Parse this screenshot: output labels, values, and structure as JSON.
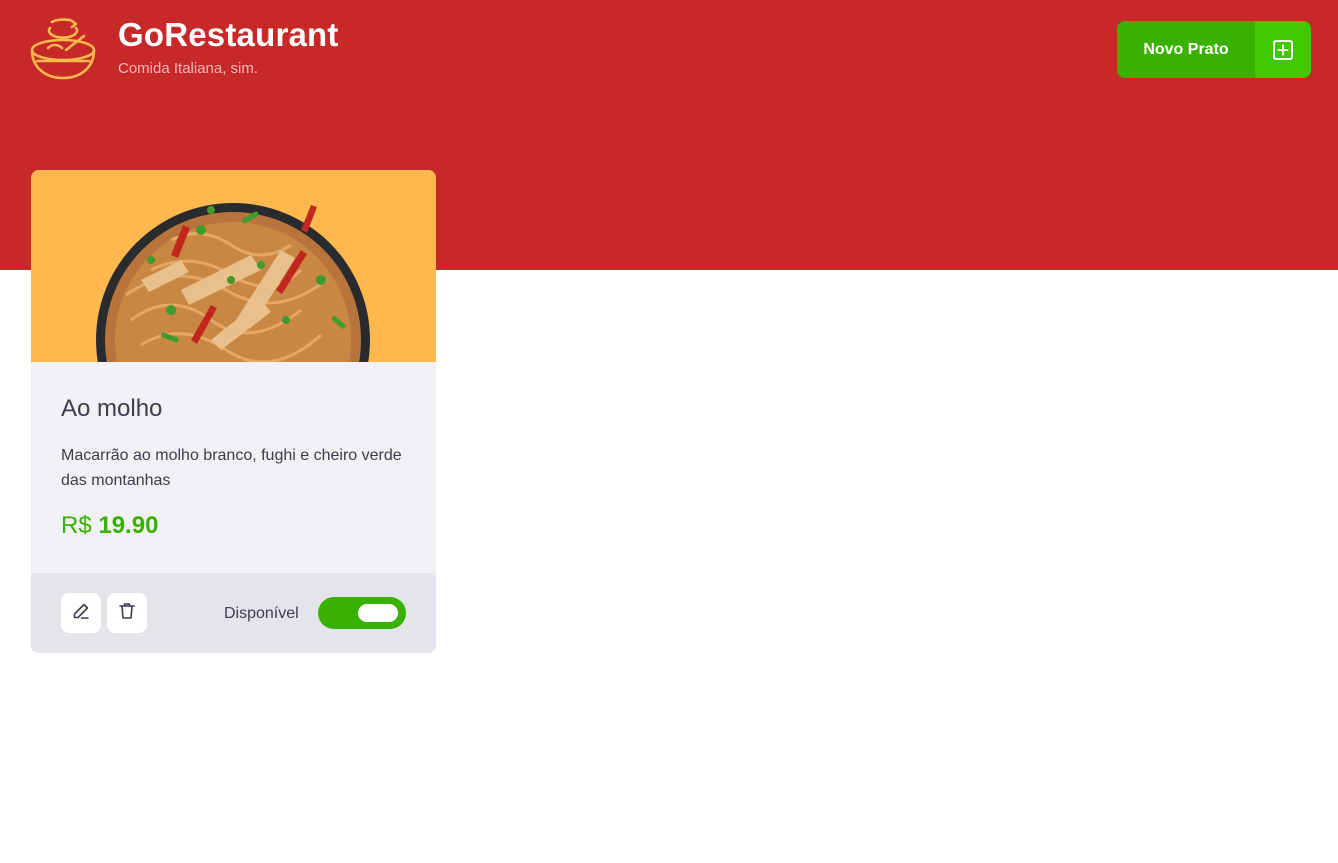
{
  "header": {
    "title": "GoRestaurant",
    "subtitle": "Comida Italiana, sim.",
    "new_button_label": "Novo Prato",
    "new_button_icon": "plus-square-icon",
    "logo_icon": "bowl-logo-icon"
  },
  "dish": {
    "name": "Ao molho",
    "description": "Macarrão ao molho branco, fughi e cheiro verde das montanhas",
    "price_prefix": "R$",
    "price_value": "19.90",
    "available_label": "Disponível",
    "available": true,
    "edit_icon": "pencil-icon",
    "delete_icon": "trash-icon"
  },
  "colors": {
    "header_bg": "#c72828",
    "accent_green": "#39b100",
    "card_image_bg": "#ffb84d",
    "card_body_bg": "#f0f0f5",
    "card_footer_bg": "#e4e4eb"
  }
}
